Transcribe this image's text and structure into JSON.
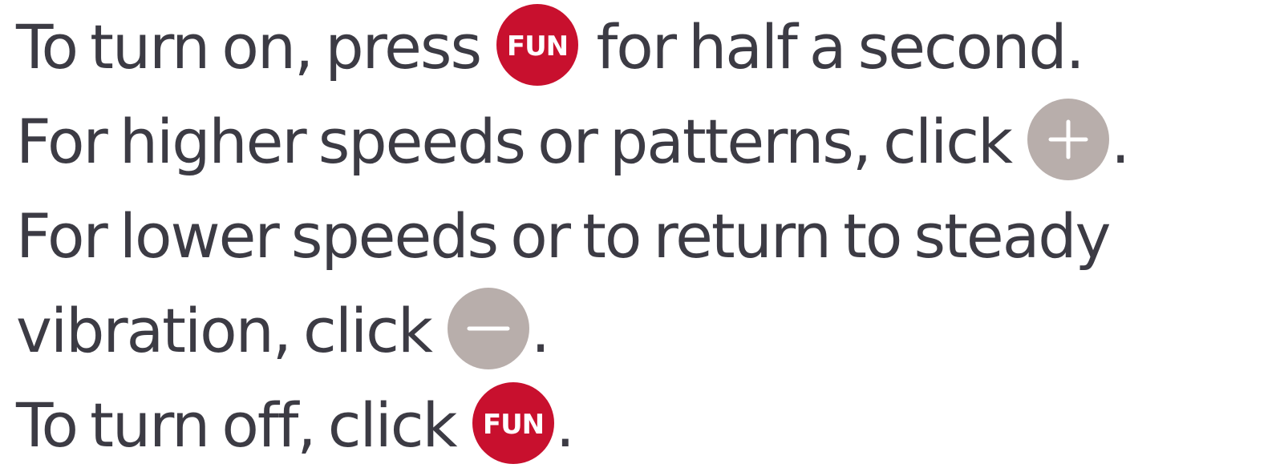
{
  "instructions": {
    "line1": {
      "before": "To turn on, press",
      "button": "FUN",
      "after": "for half a second."
    },
    "line2": {
      "before": "For higher speeds or patterns, click",
      "button_icon": "plus-icon",
      "after": "."
    },
    "line3": {
      "text": "For lower speeds or to return to steady"
    },
    "line4": {
      "before": "vibration, click",
      "button_icon": "minus-icon",
      "after": "."
    },
    "line5": {
      "before": "To turn off, click",
      "button": "FUN",
      "after": "."
    }
  },
  "colors": {
    "text": "#3c3b44",
    "fun_button": "#c8102e",
    "control_button": "#b8aeab",
    "button_glyph": "#ffffff"
  }
}
